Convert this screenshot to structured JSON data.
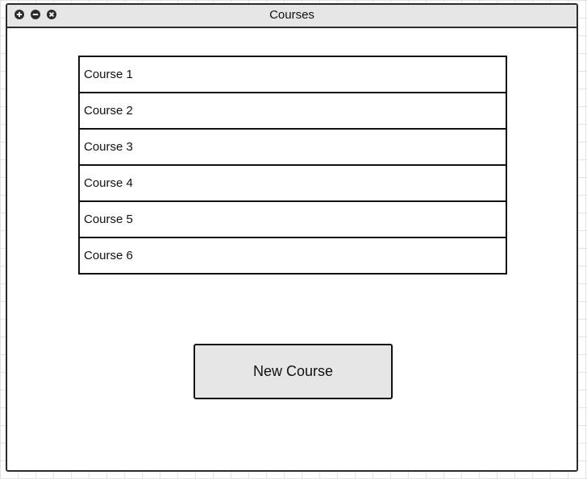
{
  "window": {
    "title": "Courses",
    "controls": [
      {
        "icon": "plus-circle-icon",
        "action": "maximize"
      },
      {
        "icon": "minus-circle-icon",
        "action": "minimize"
      },
      {
        "icon": "close-circle-icon",
        "action": "close"
      }
    ]
  },
  "courses": [
    {
      "label": "Course 1"
    },
    {
      "label": "Course 2"
    },
    {
      "label": "Course 3"
    },
    {
      "label": "Course 4"
    },
    {
      "label": "Course 5"
    },
    {
      "label": "Course 6"
    }
  ],
  "actions": {
    "new_course_label": "New Course"
  },
  "colors": {
    "titlebar_bg": "#e6e6e6",
    "button_bg": "#e6e6e6",
    "border": "#111111",
    "grid": "#e3e3e3"
  }
}
